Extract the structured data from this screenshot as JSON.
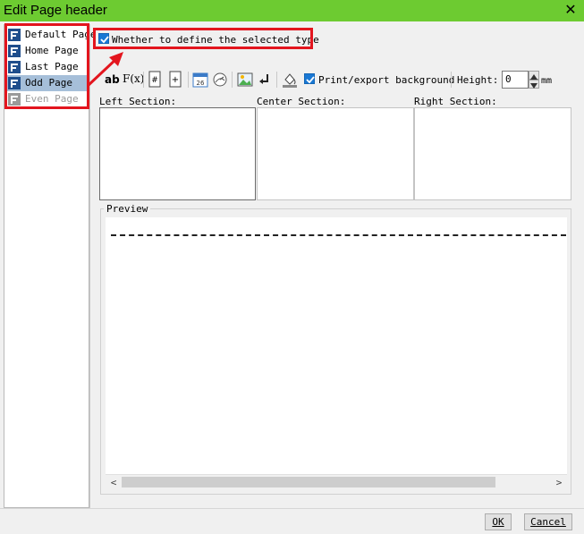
{
  "window": {
    "title": "Edit Page header"
  },
  "sidebar": {
    "items": [
      {
        "label": "Default Page"
      },
      {
        "label": "Home Page"
      },
      {
        "label": "Last Page"
      },
      {
        "label": "Odd Page"
      },
      {
        "label": "Even Page"
      }
    ]
  },
  "define_type": {
    "label": "Whether to define the selected type"
  },
  "toolbar": {
    "print_background_label": "Print/export background",
    "height_label": "Height:",
    "height_value": "0",
    "unit_label": "mm",
    "text_icon_label": "ab",
    "formula_icon_label": "F(x)",
    "date_icon_label": "26"
  },
  "sections": {
    "left_label": "Left Section:",
    "center_label": "Center Section:",
    "right_label": "Right Section:"
  },
  "preview": {
    "label": "Preview"
  },
  "buttons": {
    "ok_label": "OK",
    "cancel_label": "Cancel"
  },
  "colors": {
    "titlebar": "#6dcb31",
    "highlight": "#e3151e",
    "selection": "#a6bfd9",
    "checkbox": "#1978d4"
  }
}
